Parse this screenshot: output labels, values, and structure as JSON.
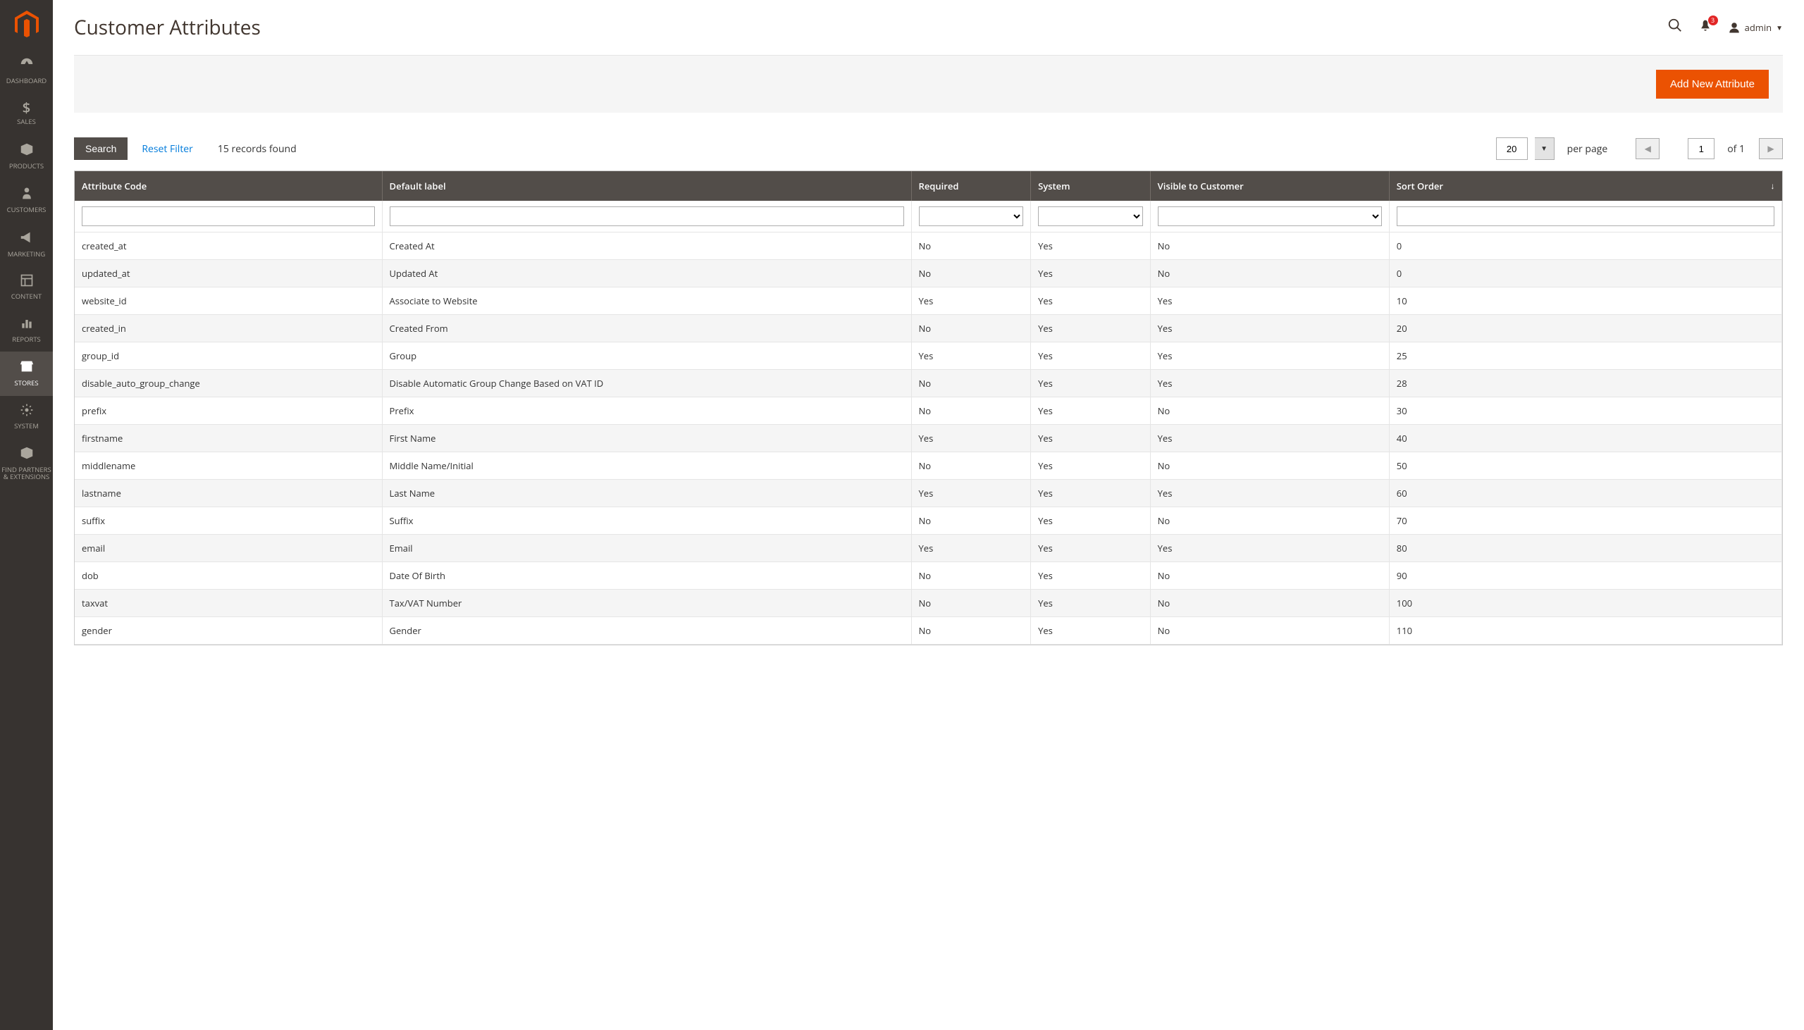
{
  "page": {
    "title": "Customer Attributes",
    "records_text": "15 records found",
    "primary_button": "Add New Attribute",
    "search_label": "Search",
    "reset_label": "Reset Filter",
    "per_page_value": "20",
    "per_page_label": "per page",
    "page_value": "1",
    "of_text": "of 1"
  },
  "header": {
    "username": "admin",
    "notif_count": "3"
  },
  "nav": [
    {
      "label": "DASHBOARD",
      "key": "dashboard"
    },
    {
      "label": "SALES",
      "key": "sales"
    },
    {
      "label": "PRODUCTS",
      "key": "products"
    },
    {
      "label": "CUSTOMERS",
      "key": "customers"
    },
    {
      "label": "MARKETING",
      "key": "marketing"
    },
    {
      "label": "CONTENT",
      "key": "content"
    },
    {
      "label": "REPORTS",
      "key": "reports"
    },
    {
      "label": "STORES",
      "key": "stores"
    },
    {
      "label": "SYSTEM",
      "key": "system"
    },
    {
      "label": "FIND PARTNERS\n& EXTENSIONS",
      "key": "partners"
    }
  ],
  "table": {
    "columns": [
      {
        "label": "Attribute Code"
      },
      {
        "label": "Default label"
      },
      {
        "label": "Required"
      },
      {
        "label": "System"
      },
      {
        "label": "Visible to Customer"
      },
      {
        "label": "Sort Order"
      }
    ],
    "rows": [
      {
        "code": "created_at",
        "label": "Created At",
        "req": "No",
        "sys": "Yes",
        "vis": "No",
        "order": "0"
      },
      {
        "code": "updated_at",
        "label": "Updated At",
        "req": "No",
        "sys": "Yes",
        "vis": "No",
        "order": "0"
      },
      {
        "code": "website_id",
        "label": "Associate to Website",
        "req": "Yes",
        "sys": "Yes",
        "vis": "Yes",
        "order": "10"
      },
      {
        "code": "created_in",
        "label": "Created From",
        "req": "No",
        "sys": "Yes",
        "vis": "Yes",
        "order": "20"
      },
      {
        "code": "group_id",
        "label": "Group",
        "req": "Yes",
        "sys": "Yes",
        "vis": "Yes",
        "order": "25"
      },
      {
        "code": "disable_auto_group_change",
        "label": "Disable Automatic Group Change Based on VAT ID",
        "req": "No",
        "sys": "Yes",
        "vis": "Yes",
        "order": "28"
      },
      {
        "code": "prefix",
        "label": "Prefix",
        "req": "No",
        "sys": "Yes",
        "vis": "No",
        "order": "30"
      },
      {
        "code": "firstname",
        "label": "First Name",
        "req": "Yes",
        "sys": "Yes",
        "vis": "Yes",
        "order": "40"
      },
      {
        "code": "middlename",
        "label": "Middle Name/Initial",
        "req": "No",
        "sys": "Yes",
        "vis": "No",
        "order": "50"
      },
      {
        "code": "lastname",
        "label": "Last Name",
        "req": "Yes",
        "sys": "Yes",
        "vis": "Yes",
        "order": "60"
      },
      {
        "code": "suffix",
        "label": "Suffix",
        "req": "No",
        "sys": "Yes",
        "vis": "No",
        "order": "70"
      },
      {
        "code": "email",
        "label": "Email",
        "req": "Yes",
        "sys": "Yes",
        "vis": "Yes",
        "order": "80"
      },
      {
        "code": "dob",
        "label": "Date Of Birth",
        "req": "No",
        "sys": "Yes",
        "vis": "No",
        "order": "90"
      },
      {
        "code": "taxvat",
        "label": "Tax/VAT Number",
        "req": "No",
        "sys": "Yes",
        "vis": "No",
        "order": "100"
      },
      {
        "code": "gender",
        "label": "Gender",
        "req": "No",
        "sys": "Yes",
        "vis": "No",
        "order": "110"
      }
    ]
  }
}
